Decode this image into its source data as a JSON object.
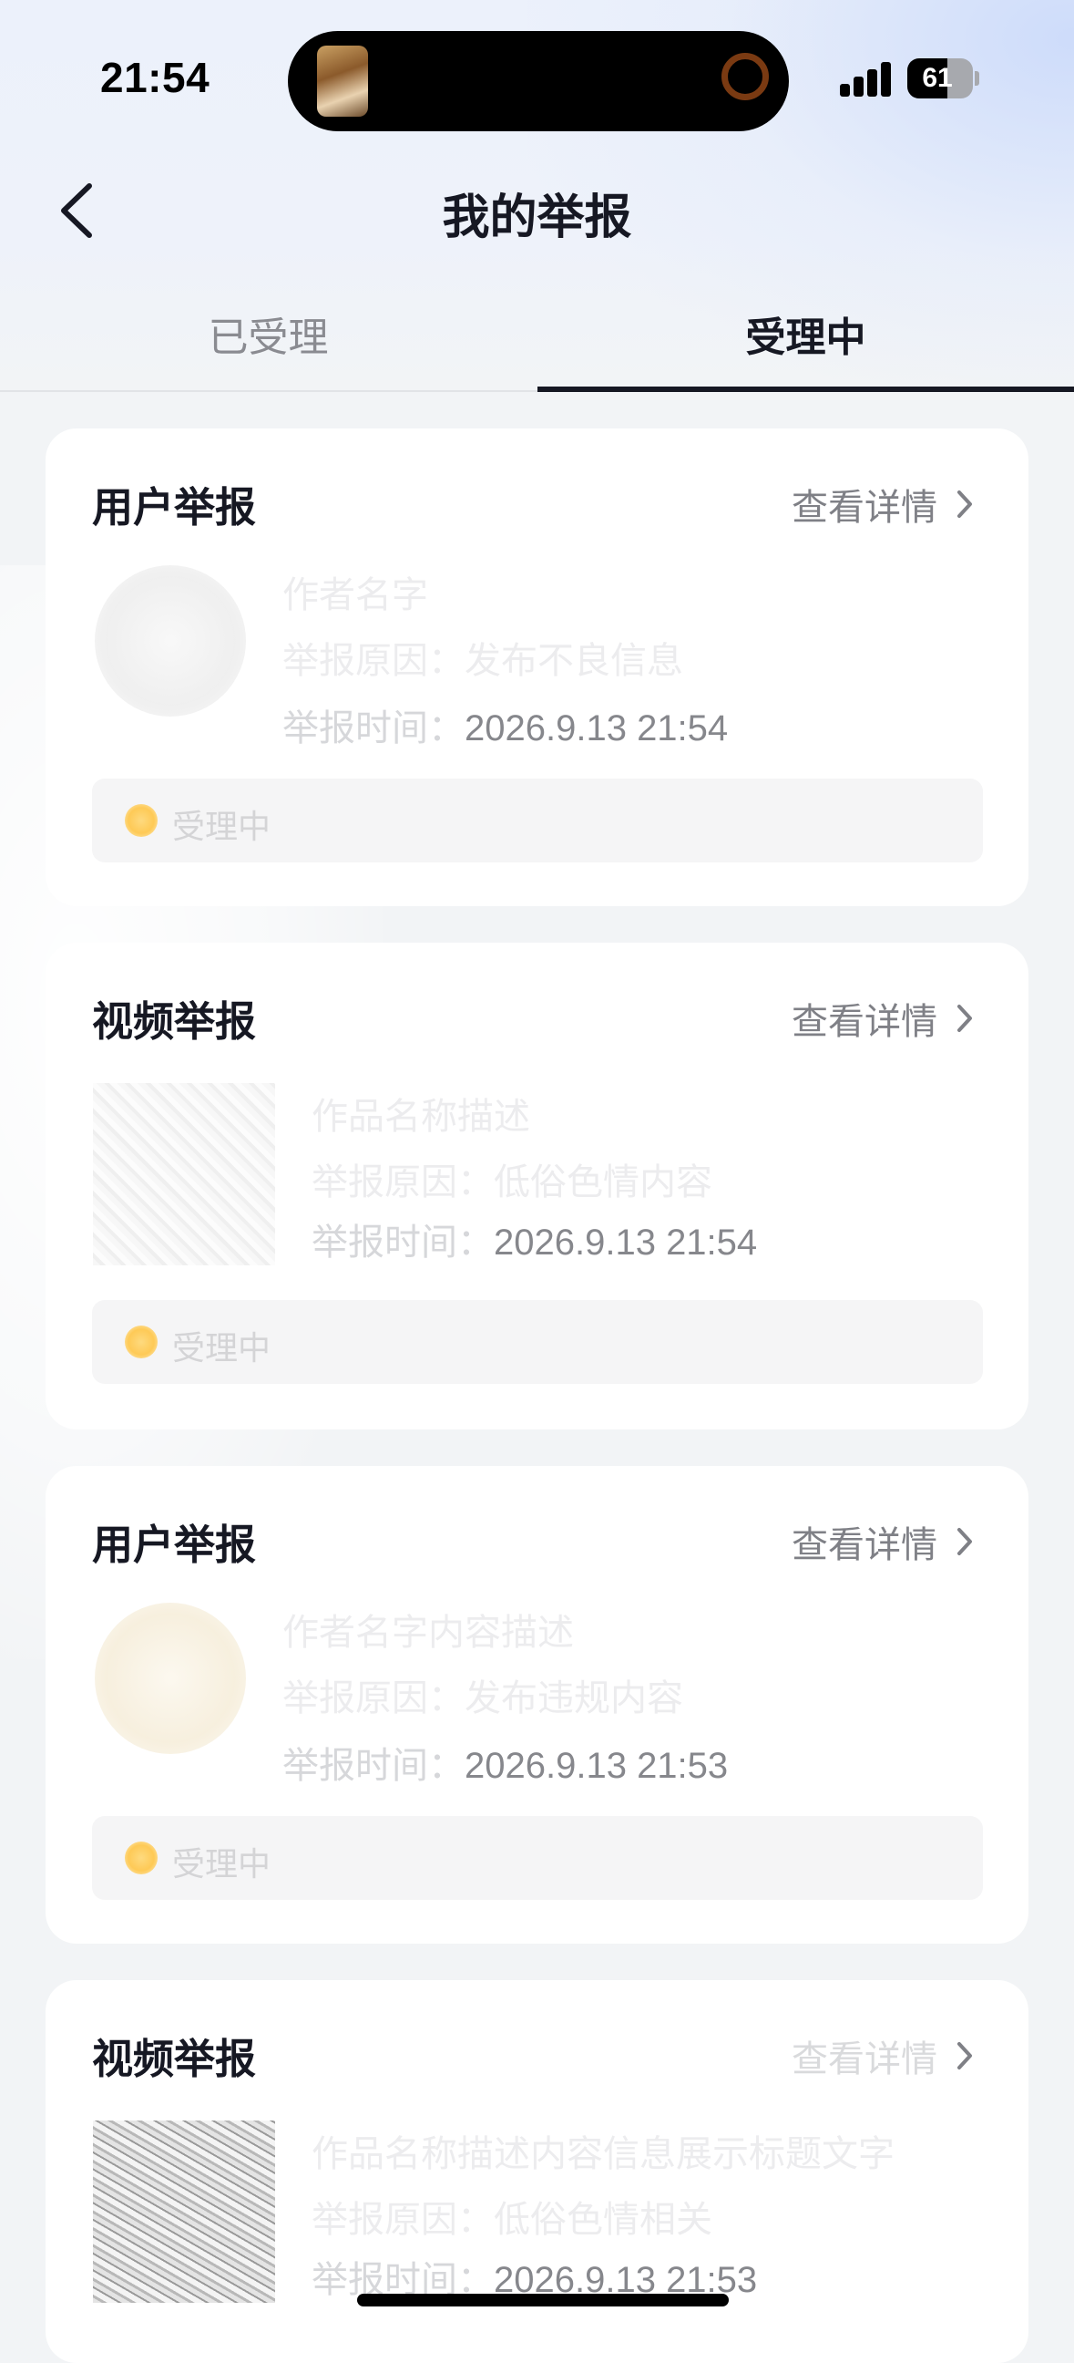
{
  "status_bar": {
    "time": "21:54",
    "battery": "61",
    "battery_level": 0.61
  },
  "nav": {
    "title": "我的举报"
  },
  "tabs": [
    {
      "label": "已受理",
      "active": false
    },
    {
      "label": "受理中",
      "active": true
    }
  ],
  "cards": [
    {
      "type": "用户举报",
      "detail_label": "查看详情",
      "name": "作者名字",
      "reason": "举报原因：发布不良信息",
      "time_label": "举报时间：",
      "time": "2026.9.13 21:54",
      "status": "受理中"
    },
    {
      "type": "视频举报",
      "detail_label": "查看详情",
      "name": "作品名称描述",
      "reason": "举报原因：低俗色情内容",
      "time_label": "举报时间：",
      "time": "2026.9.13 21:54",
      "status": "受理中"
    },
    {
      "type": "用户举报",
      "detail_label": "查看详情",
      "name": "作者名字内容描述",
      "reason": "举报原因：发布违规内容",
      "time_label": "举报时间：",
      "time": "2026.9.13 21:53",
      "status": "受理中"
    },
    {
      "type": "视频举报",
      "detail_label": "查看详情",
      "name": "作品名称描述内容信息展示标题文字",
      "reason": "举报原因：低俗色情相关",
      "time_label": "举报时间：",
      "time": "2026.9.13 21:53"
    }
  ]
}
